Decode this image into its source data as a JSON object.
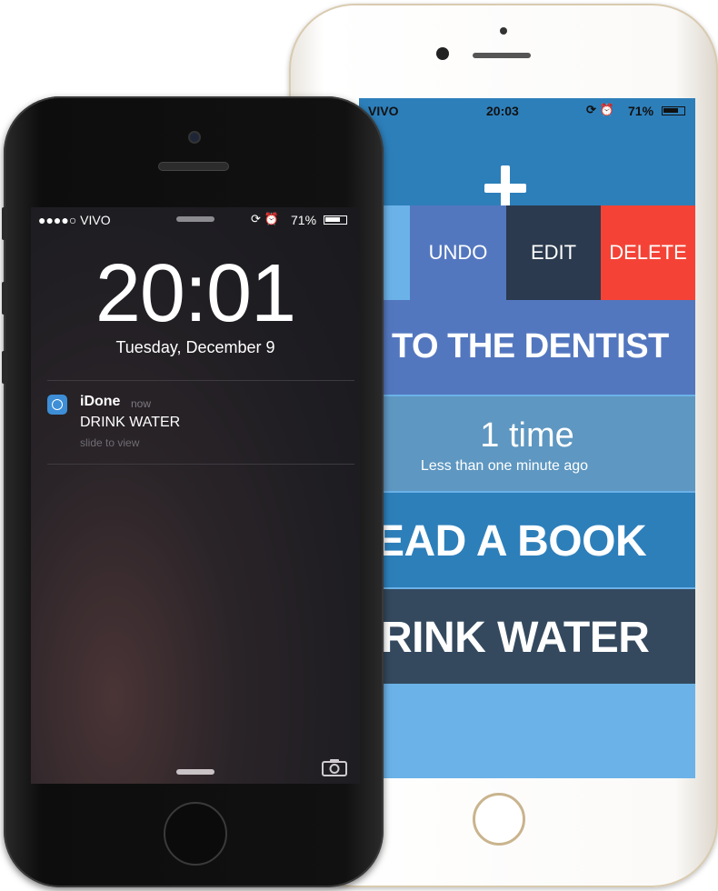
{
  "back_phone": {
    "status": {
      "carrier": "VIVO",
      "time": "20:03",
      "battery": "71%"
    },
    "add_button_icon": "plus-icon",
    "actions": {
      "undo": "UNDO",
      "edit": "EDIT",
      "delete": "DELETE"
    },
    "tasks": [
      {
        "title": "TO THE DENTIST"
      },
      {
        "count": "1 time",
        "subtitle": "Less than one minute ago"
      },
      {
        "title": "EAD A BOOK"
      },
      {
        "title": "RINK WATER"
      }
    ],
    "colors": {
      "header": "#2d7fba",
      "undo": "#5377bf",
      "edit": "#2b3a4e",
      "delete": "#f44336",
      "water": "#34495e"
    }
  },
  "front_phone": {
    "status": {
      "carrier": "●●●●○ VIVO",
      "battery": "71%"
    },
    "lock_time": "20:01",
    "lock_date": "Tuesday, December 9",
    "notification": {
      "app": "iDone",
      "when": "now",
      "message": "DRINK WATER",
      "hint": "slide to view"
    },
    "camera_icon": "camera-icon"
  }
}
